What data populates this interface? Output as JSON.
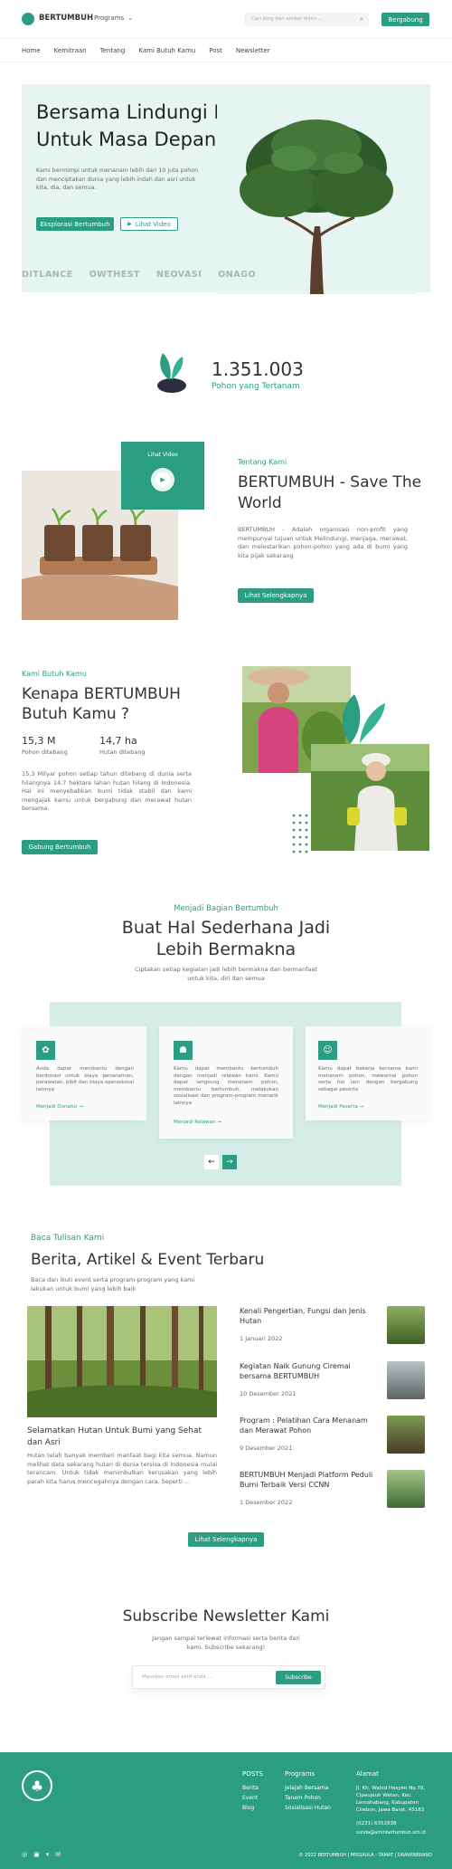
{
  "header": {
    "logo_text": "BERTUMBUH",
    "programs_label": "Programs",
    "search_placeholder": "Cari blog dan artikel disini ...",
    "join_button": "Bergabung"
  },
  "nav": {
    "items": [
      "Home",
      "Kemitraan",
      "Tentang",
      "Kami Butuh Kamu",
      "Post",
      "Newsletter"
    ]
  },
  "hero": {
    "title_line1": "Bersama Lindungi Bumi Kita",
    "title_line2": "Untuk Masa Depan",
    "description": "Kami bermimpi untuk menanam lebih dari 10 juta pohon dan menciptakan dunia yang lebih indah dan asri untuk kita, dia, dan semua.",
    "explore_button": "Eksplorasi Bertumbuh",
    "video_button": "Lihat Video",
    "partners": [
      "DITLANCE",
      "OWTHEST",
      "NEOVASI",
      "ONAGO"
    ]
  },
  "stats": {
    "count": "1.351.003",
    "label": "Pohon yang Tertanam"
  },
  "about": {
    "video_label": "Lihat Video",
    "kicker": "Tentang Kami",
    "title": "BERTUMBUH - Save The World",
    "description": "BERTUMBUH - Adalah organisasi non-profit yang mempunyai tujuan untuk Melindungi, menjaga, merawat, dan melestarikan pohon-pohon yang ada di bumi yang kita pijak sekarang",
    "button": "Lihat Selengkapnya"
  },
  "need": {
    "kicker": "Kami Butuh Kamu",
    "title_line1": "Kenapa BERTUMBUH",
    "title_line2": "Butuh Kamu ?",
    "stat1_value": "15,3 M",
    "stat1_label": "Pohon ditebang",
    "stat2_value": "14,7 ha",
    "stat2_label": "Hutan ditebang",
    "description": "15,3 Milyar pohon setiap tahun ditebang di dunia serta hilangnya 14,7 hektare lahan hutan hilang di Indonesia. Hal ini menyebabkan bumi tidak stabil dan kami mengajak kamu untuk bergabung dan merawat hutan bersama.",
    "button": "Gabung Bertumbuh"
  },
  "join": {
    "kicker": "Menjadi Bagian Bertumbuh",
    "title_line1": "Buat Hal Sederhana Jadi",
    "title_line2": "Lebih Bermakna",
    "subtitle_line1": "Ciptakan setiap kegiatan jadi lebih bermakna dan bermanfaat",
    "subtitle_line2": "untuk kita, diri dan semua",
    "cards": [
      {
        "text": "Anda dapat membantu dengan berdonasi untuk biaya penanaman, perawatan, bibit dan biaya operasional lainnya",
        "link": "Menjadi Donatur →",
        "icon": "donate-icon"
      },
      {
        "text": "Kamu dapat membantu bertumbuh dengan menjadi relawan kami. Kamu dapat langsung menanam pohon, membantu bertumbuh, melakukan sosialisasi dan program-program menarik lainnya",
        "link": "Menjadi Relawan →",
        "icon": "team-icon"
      },
      {
        "text": "Kamu dapat bekerja bersama kami menanam pohon, mewarnai pohon serta hal lain dengan bergabung sebagai peserta",
        "link": "Menjadi Peserta →",
        "icon": "person-icon"
      }
    ],
    "prev": "←",
    "next": "→"
  },
  "articles": {
    "kicker": "Baca Tulisan Kami",
    "title": "Berita, Artikel & Event Terbaru",
    "subtitle_line1": "Baca dan ikuti event serta program-program yang kami",
    "subtitle_line2": "lakukan untuk bumi yang lebih baik",
    "featured_title": "Selamatkan Hutan Untuk Bumi yang Sehat dan Asri",
    "featured_text": "Hutan telah banyak memberi manfaat bagi kita semua. Namun melihat data sekarang hutan di dunia tersisa di Indonesia mulai terancam. Untuk tidak menimbulkan kerusakan yang lebih parah kita harus mencegahnya dengan cara. Seperti ...",
    "items": [
      {
        "title": "Kenali Pengertian, Fungsi dan Jenis Hutan",
        "date": "1 Januari 2022"
      },
      {
        "title": "Kegiatan Naik Gunung Ciremai bersama BERTUMBUH",
        "date": "10 Desember 2021"
      },
      {
        "title": "Program : Pelatihan Cara Menanam dan Merawat Pohon",
        "date": "9 Desember 2021"
      },
      {
        "title": "BERTUMBUH Menjadi Platform Peduli Bumi Terbaik Versi CCNN",
        "date": "1 Desember 2022"
      }
    ],
    "button": "Lihat Selengkapnya"
  },
  "newsletter": {
    "title": "Subscribe Newsletter Kami",
    "subtitle_line1": "Jangan sampai terlewat informasi serta berita dari",
    "subtitle_line2": "kami. Subscribe sekarang!",
    "placeholder": "Masukan email aktif anda ...",
    "button": "Subscribe"
  },
  "footer": {
    "posts_title": "POSTS",
    "posts_items": [
      "Berita",
      "Event",
      "Blog"
    ],
    "programs_title": "Programs",
    "programs_items": [
      "Jelajah Bersama",
      "Tanam Pohon",
      "Sosialisasi Hutan"
    ],
    "address_title": "Alamat",
    "address": "Jl. Kh. Wahid Hasyim No.78, Cipeujeuh Wetan, Kec. Lemahabang, Kabupaten Cirebon, Jawa Barat, 45183",
    "phone": "(0231) 6352838",
    "email": "sunda@aminbertumbuh.sch.id",
    "copyright": "© 2022 BERTUMBUH | MISSAULA - TAMAT | DRAWINBRAND"
  }
}
